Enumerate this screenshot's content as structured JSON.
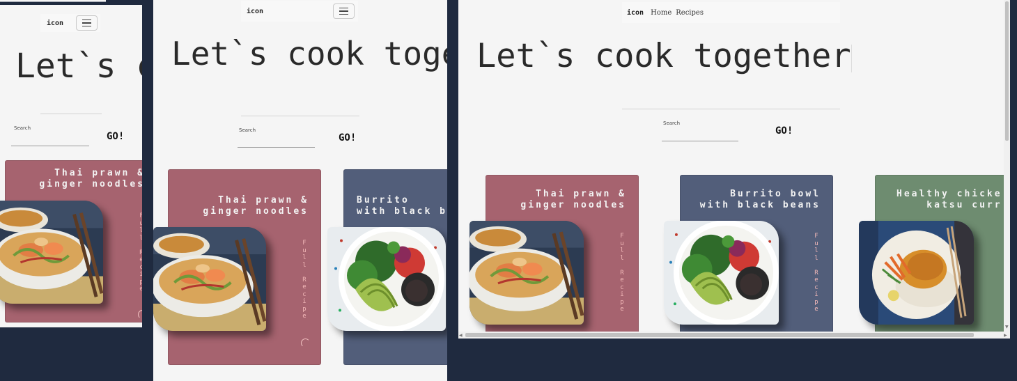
{
  "nav": {
    "brand": "icon",
    "links": [
      "Home",
      "Recipes"
    ]
  },
  "hero": {
    "title": "Let`s cook together",
    "title_small_crop": "Let`s c",
    "title_medium_crop": "Let`s cook toge"
  },
  "search": {
    "label": "Search",
    "button": "GO!"
  },
  "cards": [
    {
      "title": "Thai prawn &\nginger noodles",
      "link": "Full Recipe",
      "color": "#a6636f",
      "image": "noodles"
    },
    {
      "title": "Burrito bowl\nwith black beans",
      "title_crop": "Burrito\nwith black b",
      "link": "Full Recipe",
      "color": "#525e7a",
      "image": "burrito-bowl"
    },
    {
      "title": "Healthy chicken\nkatsu curry",
      "title_crop": "Healthy chicke\nkatsu curr",
      "link": "Full Recipe",
      "color": "#6e8c70",
      "image": "katsu-curry"
    }
  ],
  "colors": {
    "background": "#1f2a3f",
    "page": "#f5f5f5",
    "link_text": "#f2b8b8"
  }
}
